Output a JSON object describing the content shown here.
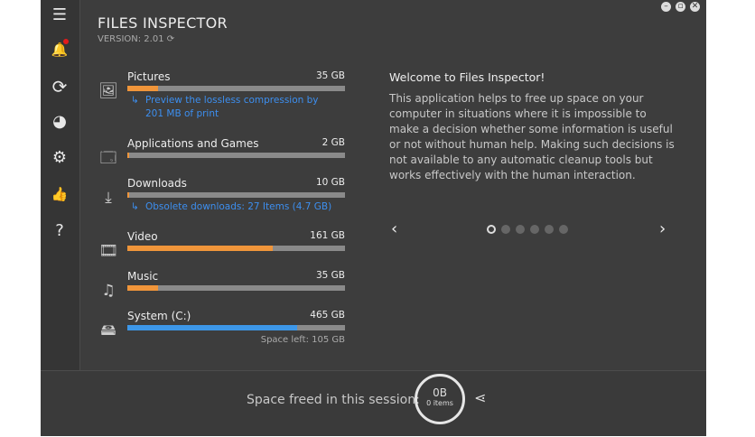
{
  "app": {
    "title": "FILES INSPECTOR",
    "version": "VERSION: 2.01"
  },
  "sidebar": [
    {
      "icon": "menu-icon",
      "glyph": "☰"
    },
    {
      "icon": "bell-icon",
      "glyph": "🔔"
    },
    {
      "icon": "refresh-icon",
      "glyph": "⟳"
    },
    {
      "icon": "globe-icon",
      "glyph": "◕"
    },
    {
      "icon": "gear-icon",
      "glyph": "⚙"
    },
    {
      "icon": "thumbs-up-icon",
      "glyph": "👍"
    },
    {
      "icon": "help-icon",
      "glyph": "?"
    }
  ],
  "categories": [
    {
      "label": "Pictures",
      "size": "35 GB",
      "percent": 14,
      "hint": "Preview the lossless compression by 201 MB of print",
      "color": "#f0953a",
      "icon": "image-icon",
      "glyph": "🖼"
    },
    {
      "label": "Applications and Games",
      "size": "2 GB",
      "percent": 1,
      "color": "#f0953a",
      "icon": "applications-icon",
      "glyph": "🗔"
    },
    {
      "label": "Downloads",
      "size": "10 GB",
      "percent": 1,
      "hint": "Obsolete downloads: 27 Items (4.7 GB)",
      "color": "#f0953a",
      "icon": "download-icon",
      "glyph": "⤓"
    },
    {
      "label": "Video",
      "size": "161 GB",
      "percent": 67,
      "color": "#f0953a",
      "icon": "video-icon",
      "glyph": "🎞"
    },
    {
      "label": "Music",
      "size": "35 GB",
      "percent": 14,
      "color": "#f0953a",
      "icon": "music-icon",
      "glyph": "♫"
    },
    {
      "label": "System (C:)",
      "size": "465 GB",
      "percent": 78,
      "space_left": "Space left: 105 GB",
      "color": "#3d97e8",
      "icon": "drive-icon",
      "glyph": "🖴"
    }
  ],
  "welcome": {
    "title": "Welcome to Files Inspector!",
    "body": "This application helps to free up space on your computer in situations where it is impossible to make a decision whether some information is useful or not without human help. Making such decisions is not available to any automatic cleanup tools but works effectively with the human interaction.",
    "page": 1,
    "pages": 6
  },
  "bottom": {
    "label": "Space freed in this session:",
    "value": "0B",
    "items": "0 items"
  }
}
